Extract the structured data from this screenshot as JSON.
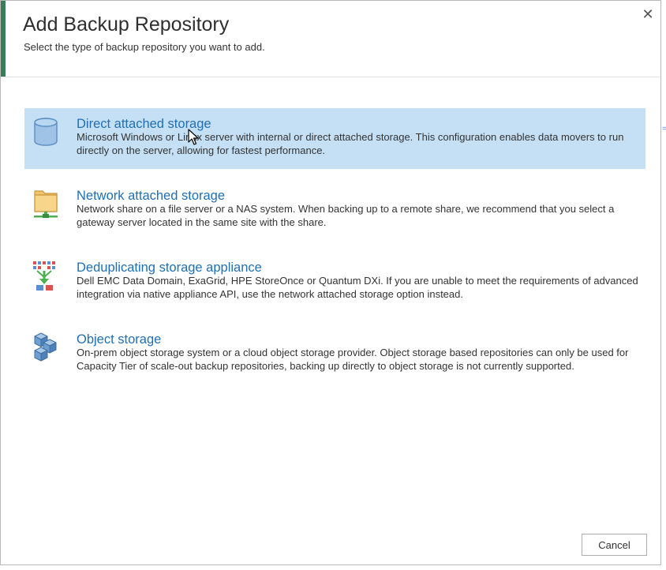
{
  "dialog": {
    "title": "Add Backup Repository",
    "subtitle": "Select the type of backup repository you want to add.",
    "close_glyph": "✕"
  },
  "options": [
    {
      "title": "Direct attached storage",
      "description": "Microsoft Windows or Linux server with internal or direct attached storage. This configuration enables data movers to run directly on the server, allowing for fastest performance.",
      "icon": "database-icon",
      "selected": true
    },
    {
      "title": "Network attached storage",
      "description": "Network share on a file server or a NAS system. When backing up to a remote share, we recommend that you select a gateway server located in the same site with the share.",
      "icon": "network-folder-icon",
      "selected": false
    },
    {
      "title": "Deduplicating storage appliance",
      "description": "Dell EMC Data Domain, ExaGrid, HPE StoreOnce or Quantum DXi. If you are unable to meet the requirements of advanced integration via native appliance API, use the network attached storage option instead.",
      "icon": "deduplication-icon",
      "selected": false
    },
    {
      "title": "Object storage",
      "description": "On-prem object storage system or a cloud object storage provider. Object storage based repositories can only be used for Capacity Tier of scale-out backup repositories, backing up directly to object storage is not currently supported.",
      "icon": "object-storage-cubes-icon",
      "selected": false
    }
  ],
  "footer": {
    "cancel_label": "Cancel"
  },
  "colors": {
    "accent_green": "#3a7d5a",
    "selected_bg": "#c5e0f5",
    "link_blue": "#1f6fb2"
  }
}
